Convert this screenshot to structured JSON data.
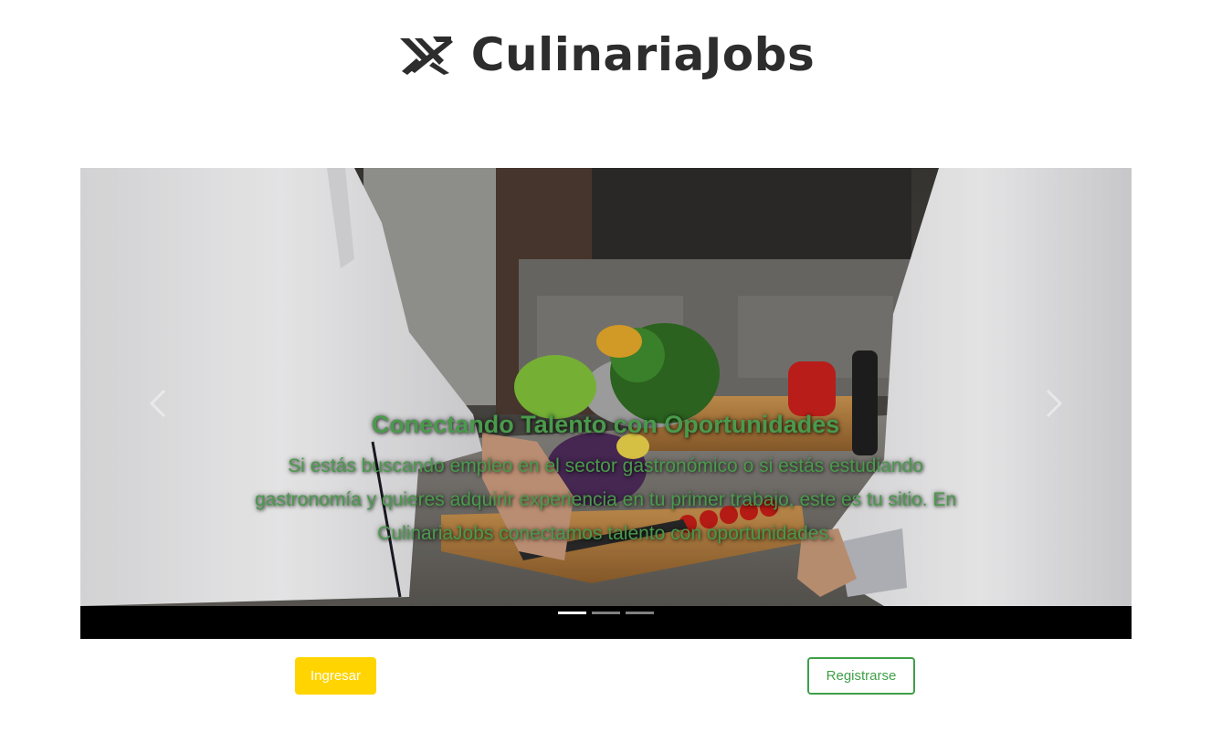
{
  "brand": {
    "name": "CulinariaJobs",
    "logo_icon": "crossed-utensils-icon",
    "text_color": "#2d2d2d"
  },
  "carousel": {
    "slide_count": 3,
    "active_slide": 1,
    "caption": {
      "title": "Conectando Talento con Oportunidades",
      "text": "Si estás buscando empleo en el sector gastronómico o si estás estudiando gastronomía y quieres adquirir experiencia en tu primer trabajo, este es tu sitio. En CulinariaJobs conectamos talento con oportunidades.",
      "color": "#4a9a4c"
    },
    "prev_icon": "chevron-left-icon",
    "next_icon": "chevron-right-icon"
  },
  "actions": {
    "login_label": "Ingresar",
    "login_color": "#ffd400",
    "register_label": "Registrarse",
    "register_color": "#3fa047"
  }
}
